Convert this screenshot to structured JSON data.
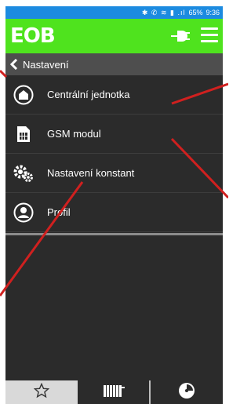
{
  "status_bar": {
    "icons_text": "✱ ✆ ≋ ▮ .ıl",
    "battery": "65%",
    "time": "9:36",
    "color": "#1c8be0"
  },
  "app_bar": {
    "logo": "EOB",
    "color": "#4fe31e",
    "icons": [
      "plug-icon",
      "hamburger-menu-icon"
    ]
  },
  "breadcrumb": {
    "title": "Nastavení"
  },
  "menu": {
    "items": [
      {
        "label": "Centrální jednotka",
        "icon": "home-icon"
      },
      {
        "label": "GSM modul",
        "icon": "sim-card-icon"
      },
      {
        "label": "Nastavení konstant",
        "icon": "gears-icon"
      },
      {
        "label": "Profil",
        "icon": "user-icon"
      }
    ]
  },
  "bottom_nav": {
    "tabs": [
      {
        "name": "favorites",
        "icon": "star-icon",
        "active": true
      },
      {
        "name": "heating",
        "icon": "radiator-icon",
        "active": false
      },
      {
        "name": "gauge",
        "icon": "gauge-icon",
        "active": false
      }
    ]
  },
  "annotation_color": "#d0201f"
}
